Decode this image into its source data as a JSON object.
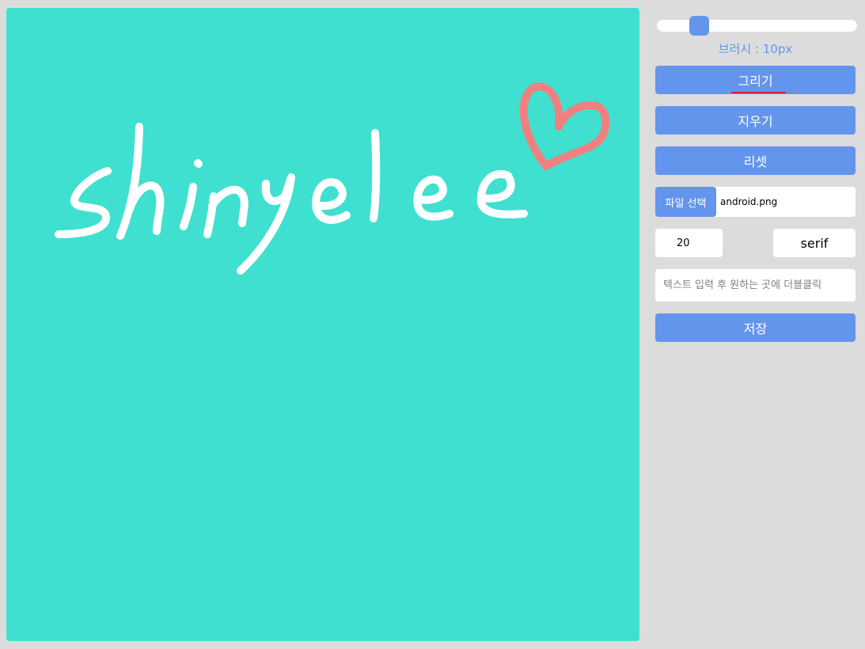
{
  "brush": {
    "label": "브러시 : 10px",
    "slider_value": 10,
    "slider_min": 1,
    "slider_max": 100
  },
  "buttons": {
    "draw": "그리기",
    "erase": "지우기",
    "reset": "리셋",
    "save": "저장"
  },
  "mode": "draw",
  "file": {
    "button_label": "파일 선택",
    "filename": "android.png"
  },
  "font": {
    "size_value": "20",
    "family": "serif"
  },
  "text_input": {
    "placeholder": "텍스트 입력 후 원하는 곳에 더블클릭",
    "value": ""
  },
  "canvas": {
    "background": "#40e0d0",
    "stroke_colors": [
      "#ffffff",
      "#f08080"
    ]
  },
  "colors": {
    "accent": "#6495ed",
    "panel_bg": "#dcdcdc"
  }
}
